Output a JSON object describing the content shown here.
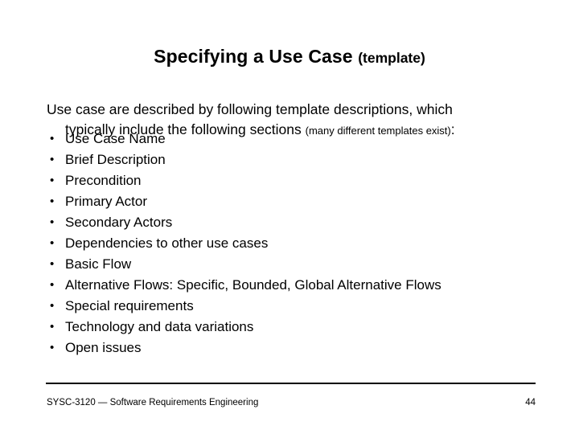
{
  "slide": {
    "title_main": "Specifying a Use Case ",
    "title_sub": "(template)",
    "lead_line1": "Use case are described by following template descriptions, which",
    "lead_line2_main": "typically include the following sections ",
    "lead_line2_note": "(many different templates exist)",
    "lead_line2_tail": ":",
    "bullet_glyph": "•",
    "bullets": [
      {
        "label": "Use Case Name"
      },
      {
        "label": "Brief Description"
      },
      {
        "label": "Precondition"
      },
      {
        "label": "Primary Actor"
      },
      {
        "label": "Secondary Actors"
      },
      {
        "label": "Dependencies to other use cases"
      },
      {
        "label": "Basic Flow"
      },
      {
        "label": "Alternative Flows: Specific, Bounded, Global Alternative Flows"
      },
      {
        "label": "Special requirements"
      },
      {
        "label": "Technology and data variations"
      },
      {
        "label": "Open issues"
      }
    ],
    "footer": {
      "course": "SYSC-3120 — Software Requirements Engineering",
      "page_number": "44"
    },
    "colors": {
      "background": "#ffffff",
      "text": "#000000",
      "rule": "#000000"
    }
  }
}
